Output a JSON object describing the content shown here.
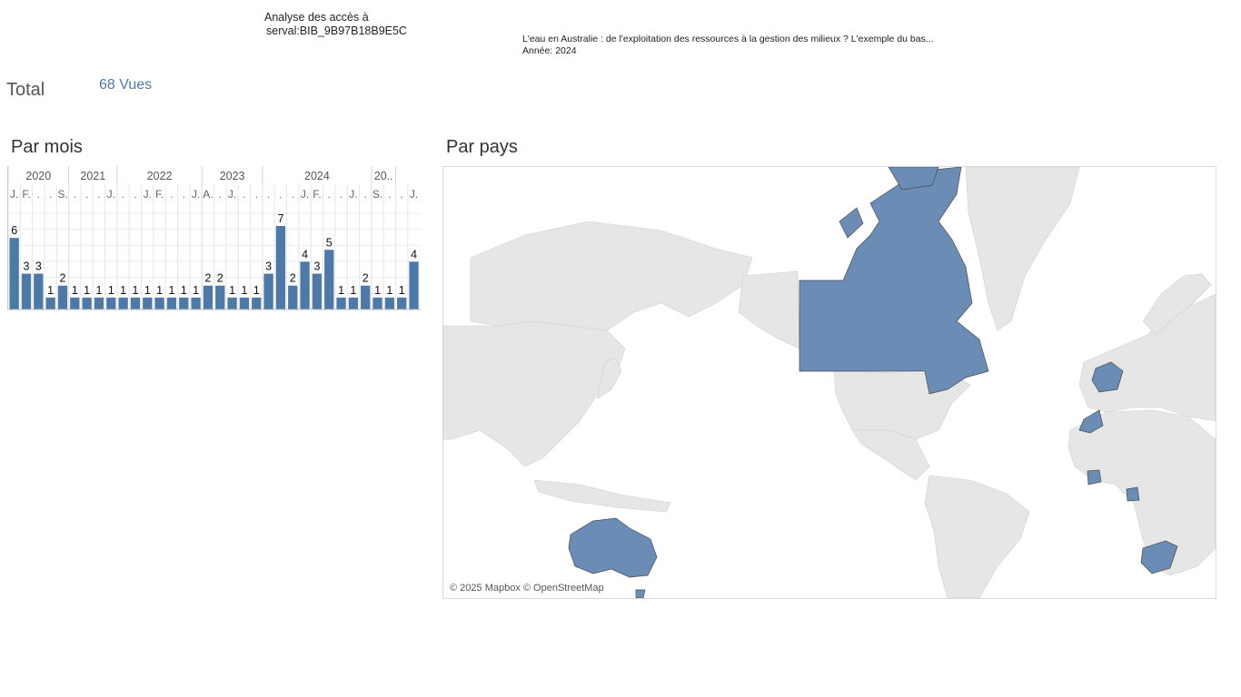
{
  "header": {
    "title_line1": "Analyse des accès à",
    "title_line2": "serval:BIB_9B97B18B9E5C",
    "doc_title": "L'eau en Australie : de l'exploitation des ressources à la gestion des milieux ? L'exemple du bas...",
    "year_line": "Année: 2024"
  },
  "total": {
    "label": "Total",
    "value": "68 Vues"
  },
  "sections": {
    "by_month": "Par mois",
    "by_country": "Par pays"
  },
  "map": {
    "attribution": "© 2025 Mapbox © OpenStreetMap",
    "highlight_color": "#6b8db5",
    "land_color": "#e6e6e6",
    "highlighted_countries": [
      "Canada",
      "France",
      "Morocco",
      "Ivory Coast",
      "Gabon",
      "South Africa",
      "Australia"
    ]
  },
  "chart_data": {
    "type": "bar",
    "years": [
      {
        "label": "2020"
      },
      {
        "label": "2021"
      },
      {
        "label": "2022"
      },
      {
        "label": "2023"
      },
      {
        "label": "2024"
      },
      {
        "label": "20.."
      }
    ],
    "months": [
      "J.",
      "F.",
      ".",
      ".",
      "S.",
      ".",
      ".",
      ".",
      "J.",
      ".",
      ".",
      "J.",
      "F.",
      ".",
      ".",
      "J.",
      "A.",
      ".",
      "J.",
      ".",
      ".",
      ".",
      ".",
      ".",
      "J.",
      "F.",
      ".",
      ".",
      "J.",
      ".",
      "S.",
      ".",
      ".",
      "J.",
      "."
    ],
    "values": [
      6,
      3,
      3,
      1,
      2,
      1,
      1,
      1,
      1,
      1,
      1,
      1,
      1,
      1,
      1,
      1,
      2,
      2,
      1,
      1,
      1,
      3,
      7,
      2,
      4,
      3,
      5,
      1,
      1,
      2,
      1,
      1,
      1,
      4
    ],
    "ylim": [
      0,
      7
    ],
    "color": "#4e79a7"
  }
}
